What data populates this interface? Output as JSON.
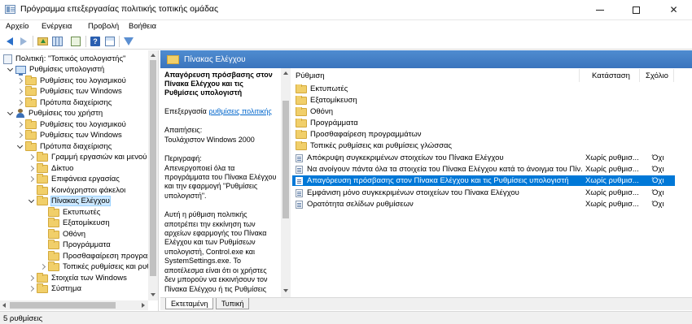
{
  "window": {
    "title": "Πρόγραμμα επεξεργασίας πολιτικής τοπικής ομάδας",
    "min_glyph": "",
    "close_glyph": "✕"
  },
  "menu": [
    "Αρχείο",
    "Ενέργεια",
    "Προβολή",
    "Βοήθεια"
  ],
  "toolbar": {
    "icons": [
      "back-icon",
      "forward-icon",
      "up-folder-icon",
      "show-hide-tree-icon",
      "export-list-icon",
      "help-icon",
      "properties-icon",
      "filter-icon"
    ],
    "help_glyph": "?"
  },
  "tree": {
    "root": "Πολιτική: \"Τοπικός υπολογιστής\"",
    "items": [
      {
        "label": "Ρυθμίσεις υπολογιστή"
      },
      {
        "label": "Ρυθμίσεις του λογισμικού"
      },
      {
        "label": "Ρυθμίσεις των Windows"
      },
      {
        "label": "Πρότυπα διαχείρισης"
      },
      {
        "label": "Ρυθμίσεις του χρήστη"
      },
      {
        "label": "Ρυθμίσεις του λογισμικού"
      },
      {
        "label": "Ρυθμίσεις των Windows"
      },
      {
        "label": "Πρότυπα διαχείρισης"
      },
      {
        "label": "Γραμμή εργασιών και μενού \""
      },
      {
        "label": "Δίκτυο"
      },
      {
        "label": "Επιφάνεια εργασίας"
      },
      {
        "label": "Κοινόχρηστοι φάκελοι"
      },
      {
        "label": "Πίνακας Ελέγχου"
      },
      {
        "label": "Εκτυπωτές"
      },
      {
        "label": "Εξατομίκευση"
      },
      {
        "label": "Οθόνη"
      },
      {
        "label": "Προγράμματα"
      },
      {
        "label": "Προσθαφαίρεση προγραμ"
      },
      {
        "label": "Τοπικές ρυθμίσεις και ρυθ"
      },
      {
        "label": "Στοιχεία των Windows"
      },
      {
        "label": "Σύστημα"
      }
    ]
  },
  "right_header": {
    "title": "Πίνακας Ελέγχου"
  },
  "description": {
    "title": "Απαγόρευση πρόσβασης στον Πίνακα Ελέγχου και τις Ρυθμίσεις υπολογιστή",
    "edit_prefix": "Επεξεργασία",
    "edit_link": "ρυθμίσεις πολιτικής",
    "requirements_label": "Απαιτήσεις:",
    "requirements_value": "Τουλάχιστον Windows 2000",
    "description_label": "Περιγραφή:",
    "description_text": "Απενεργοποιεί όλα τα προγράμματα του Πίνακα Ελέγχου και την εφαρμογή \"Ρυθμίσεις υπολογιστή\".",
    "description_more": "Αυτή η ρύθμιση πολιτικής αποτρέπει την εκκίνηση των αρχείων εφαρμογής του Πίνακα Ελέγχου και των Ρυθμίσεων υπολογιστή, Control.exe και SystemSettings.exe. Το αποτέλεσμα είναι ότι οι χρήστες δεν μπορούν να εκκινήσουν τον Πίνακα Ελέγχου ή τις Ρυθμίσεις"
  },
  "list": {
    "columns": {
      "name": "Ρύθμιση",
      "state": "Κατάσταση",
      "comment": "Σχόλιο"
    },
    "folders": [
      "Εκτυπωτές",
      "Εξατομίκευση",
      "Οθόνη",
      "Προγράμματα",
      "Προσθαφαίρεση προγραμμάτων",
      "Τοπικές ρυθμίσεις και ρυθμίσεις γλώσσας"
    ],
    "settings": [
      {
        "name": "Απόκρυψη συγκεκριμένων στοιχείων του Πίνακα Ελέγχου",
        "state": "Χωρίς ρυθμισ...",
        "comment": "Όχι"
      },
      {
        "name": "Να ανοίγουν πάντα όλα τα στοιχεία του Πίνακα Ελέγχου κατά το άνοιγμα του Πίν...",
        "state": "Χωρίς ρυθμισ...",
        "comment": "Όχι"
      },
      {
        "name": "Απαγόρευση πρόσβασης στον Πίνακα Ελέγχου και τις Ρυθμίσεις υπολογιστή",
        "state": "Χωρίς ρυθμισ...",
        "comment": "Όχι"
      },
      {
        "name": "Εμφάνιση μόνο συγκεκριμένων στοιχείων του Πίνακα Ελέγχου",
        "state": "Χωρίς ρυθμισ...",
        "comment": "Όχι"
      },
      {
        "name": "Ορατότητα σελίδων ρυθμίσεων",
        "state": "Χωρίς ρυθμισ...",
        "comment": "Όχι"
      }
    ]
  },
  "tabs": {
    "extended": "Εκτεταμένη",
    "standard": "Τυπική"
  },
  "status": {
    "text": "5 ρυθμίσεις"
  }
}
